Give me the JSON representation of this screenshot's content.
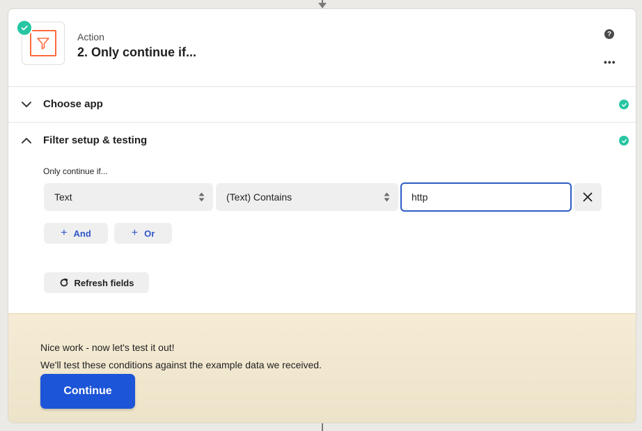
{
  "step": {
    "kind_label": "Action",
    "title": "2. Only continue if...",
    "app_icon": "filter-icon",
    "status": "complete"
  },
  "header_actions": {
    "help_icon": "question-icon",
    "help_glyph": "?",
    "more_icon": "more-icon",
    "more_glyph": "•••"
  },
  "sections": {
    "choose_app": {
      "label": "Choose app",
      "expanded": false,
      "complete": true
    },
    "filter_setup": {
      "label": "Filter setup & testing",
      "expanded": true,
      "complete": true
    }
  },
  "filter": {
    "caption": "Only continue if...",
    "field_value": "Text",
    "operator_value": "(Text) Contains",
    "value_input": "http",
    "and_label": "And",
    "or_label": "Or",
    "refresh_label": "Refresh fields"
  },
  "test_panel": {
    "line1": "Nice work - now let's test it out!",
    "line2": "We'll test these conditions against the example data we received.",
    "continue_label": "Continue"
  },
  "colors": {
    "accent_blue": "#1d55d8",
    "link_blue": "#3057c7",
    "success_green": "#26c6a2",
    "filter_orange": "#ff6a3d",
    "panel_tan": "#f6ecd6"
  }
}
